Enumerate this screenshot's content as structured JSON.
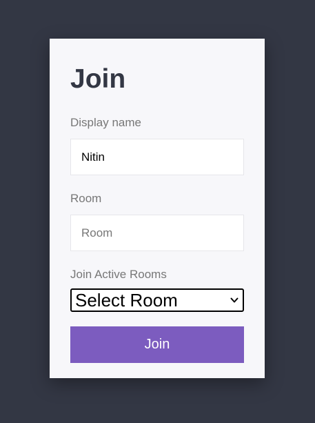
{
  "form": {
    "title": "Join",
    "display_name": {
      "label": "Display name",
      "value": "Nitin",
      "placeholder": "Display name"
    },
    "room": {
      "label": "Room",
      "value": "",
      "placeholder": "Room"
    },
    "active_rooms": {
      "label": "Join Active Rooms",
      "selected": "Select Room"
    },
    "submit_label": "Join"
  },
  "colors": {
    "background": "#333744",
    "card": "#f7f7fa",
    "accent": "#7c5cbf",
    "label": "#777777"
  },
  "icons": {
    "select_arrow": "chevron-down-icon"
  }
}
